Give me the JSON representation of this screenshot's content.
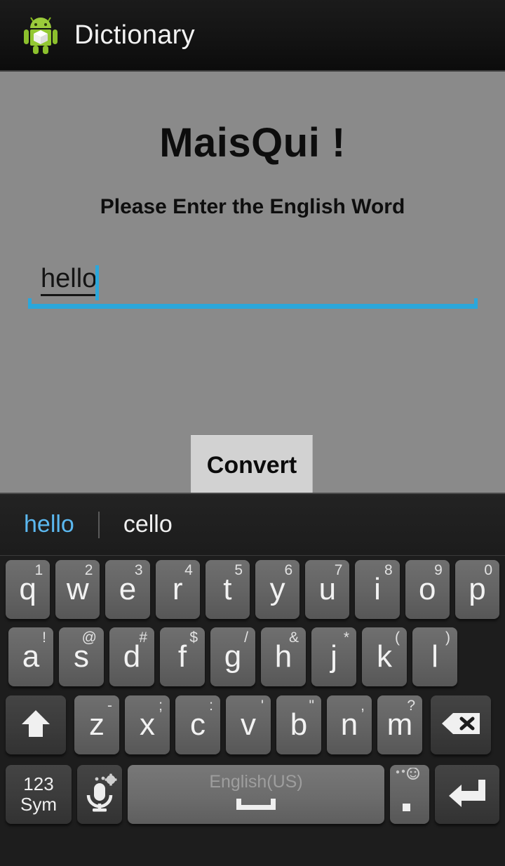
{
  "actionbar": {
    "icon": "android-robot-icon",
    "title": "Dictionary"
  },
  "content": {
    "heading": "MaisQui !",
    "subheading": "Please Enter the English Word",
    "input": {
      "value": "hello",
      "placeholder": "",
      "caret_visible": true,
      "underline_color": "#2ba7db"
    },
    "convert_button": "Convert"
  },
  "keyboard": {
    "suggestions": [
      {
        "text": "hello",
        "selected": true
      },
      {
        "text": "cello",
        "selected": false
      }
    ],
    "row1": [
      {
        "key": "q",
        "hint": "1"
      },
      {
        "key": "w",
        "hint": "2"
      },
      {
        "key": "e",
        "hint": "3"
      },
      {
        "key": "r",
        "hint": "4"
      },
      {
        "key": "t",
        "hint": "5"
      },
      {
        "key": "y",
        "hint": "6"
      },
      {
        "key": "u",
        "hint": "7"
      },
      {
        "key": "i",
        "hint": "8"
      },
      {
        "key": "o",
        "hint": "9"
      },
      {
        "key": "p",
        "hint": "0"
      }
    ],
    "row2": [
      {
        "key": "a",
        "hint": "!"
      },
      {
        "key": "s",
        "hint": "@"
      },
      {
        "key": "d",
        "hint": "#"
      },
      {
        "key": "f",
        "hint": "$"
      },
      {
        "key": "g",
        "hint": "/"
      },
      {
        "key": "h",
        "hint": "&"
      },
      {
        "key": "j",
        "hint": "*"
      },
      {
        "key": "k",
        "hint": "("
      },
      {
        "key": "l",
        "hint": ")"
      }
    ],
    "row3": [
      {
        "key": "z",
        "hint": "-"
      },
      {
        "key": "x",
        "hint": ";"
      },
      {
        "key": "c",
        "hint": ":"
      },
      {
        "key": "v",
        "hint": "'"
      },
      {
        "key": "b",
        "hint": "\""
      },
      {
        "key": "n",
        "hint": ","
      },
      {
        "key": "m",
        "hint": "?"
      }
    ],
    "shift_key": "shift-arrow-icon",
    "delete_key": "backspace-icon",
    "symbols_key_line1": "123",
    "symbols_key_line2": "Sym",
    "mic_key": "microphone-icon",
    "space_key_label": "English(US)",
    "period_key": ".",
    "period_key_hint": "smiley-icon",
    "enter_key": "enter-arrow-icon"
  },
  "colors": {
    "app_background": "#8a8a8a",
    "actionbar": "#141414",
    "accent_blue": "#2ba7db",
    "suggestion_selected": "#5bb8f0",
    "keyboard_background": "#1d1d1d",
    "key_face": "#636363",
    "key_dark": "#3b3b3b",
    "convert_button": "#d2d2d2"
  }
}
